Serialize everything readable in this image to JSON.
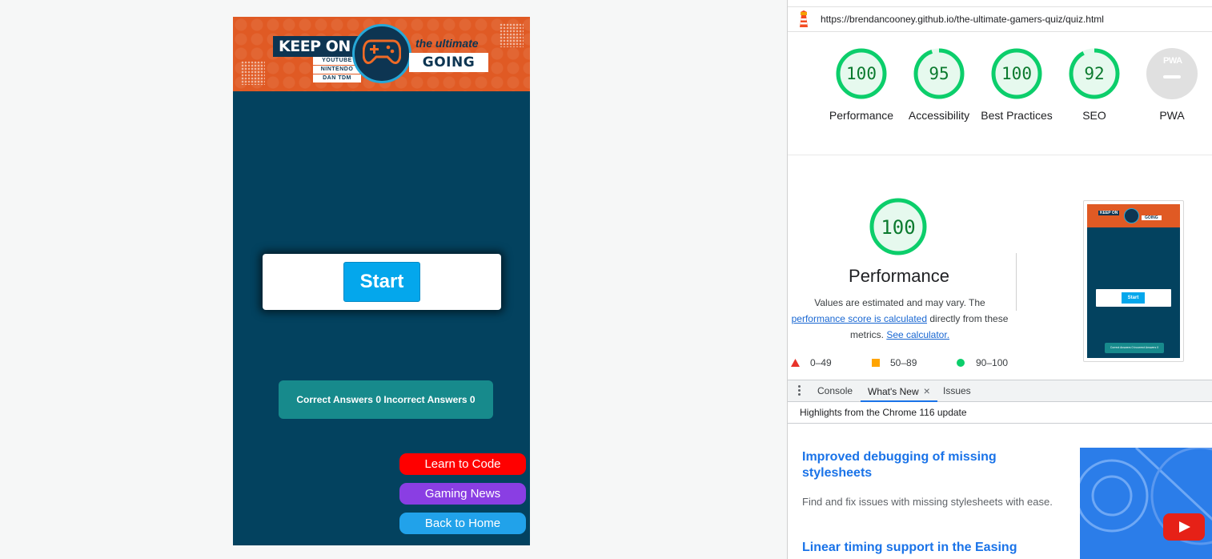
{
  "quiz": {
    "logo": {
      "keep_on": "KEEP ON",
      "tags": [
        "YOUTUBE",
        "NINTENDO",
        "DAN TDM"
      ],
      "tagline": "the ultimate",
      "going": "GOING"
    },
    "start_label": "Start",
    "score_text": "Correct Answers 0 Incorrect Answers 0",
    "links": {
      "learn_code": "Learn to Code",
      "gaming_news": "Gaming News",
      "back_home": "Back to Home"
    }
  },
  "devtools": {
    "url": "https://brendancooney.github.io/the-ultimate-gamers-quiz/quiz.html",
    "scores": [
      {
        "label": "Performance",
        "value": 100
      },
      {
        "label": "Accessibility",
        "value": 95
      },
      {
        "label": "Best Practices",
        "value": 100
      },
      {
        "label": "SEO",
        "value": 92
      },
      {
        "label": "PWA",
        "value": null,
        "badge": "PWA"
      }
    ],
    "performance": {
      "score": "100",
      "title": "Performance",
      "desc_1": "Values are estimated and may vary. The",
      "link_1": "performance score is calculated",
      "desc_2": "directly from these metrics.",
      "link_2": "See calculator."
    },
    "legend": [
      {
        "range": "0–49",
        "color": "#e8332a"
      },
      {
        "range": "50–89",
        "color": "#ffa400"
      },
      {
        "range": "90–100",
        "color": "#0cce6b"
      }
    ],
    "drawer_tabs": [
      "Console",
      "What's New",
      "Issues"
    ],
    "highlights": "Highlights from the Chrome 116 update",
    "whats_new": [
      {
        "title": "Improved debugging of missing stylesheets",
        "desc": "Find and fix issues with missing stylesheets with ease."
      },
      {
        "title": "Linear timing support in the Easing"
      }
    ],
    "thumbnail": {
      "start": "Start",
      "score": "Correct Answers 0 Incorrect Answers 0",
      "keep_on": "KEEP ON",
      "going": "GOING"
    },
    "colors": {
      "pass": "#0cce6b",
      "text_pass": "#0b7a2e",
      "link": "#1a73e8"
    }
  }
}
